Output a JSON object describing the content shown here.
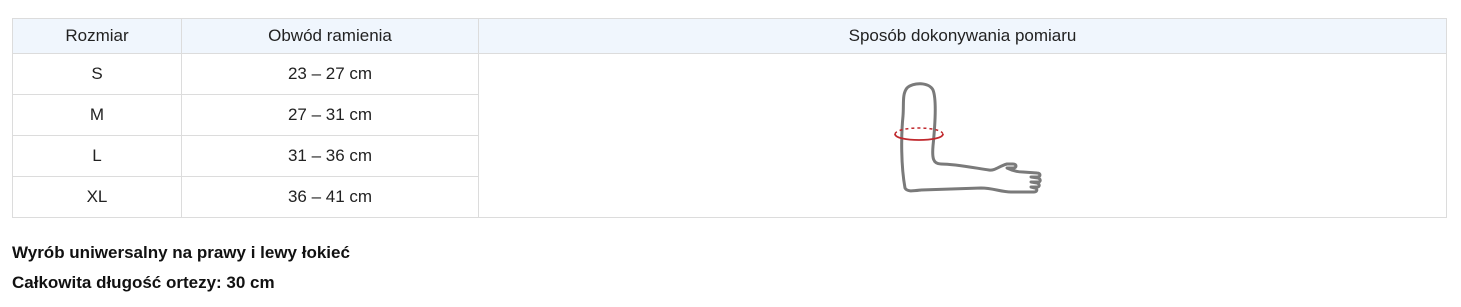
{
  "table": {
    "headers": [
      "Rozmiar",
      "Obwód ramienia",
      "Sposób dokonywania pomiaru"
    ],
    "rows": [
      {
        "size": "S",
        "circumference": "23 – 27 cm"
      },
      {
        "size": "M",
        "circumference": "27 – 31 cm"
      },
      {
        "size": "L",
        "circumference": "31 – 36 cm"
      },
      {
        "size": "XL",
        "circumference": "36 – 41 cm"
      }
    ],
    "illustration": "arm-measurement-icon"
  },
  "notes": {
    "line1": "Wyrób uniwersalny na prawy i lewy łokieć",
    "line2": "Całkowita długość ortezy: 30 cm"
  },
  "colors": {
    "header_bg": "#f0f6fd",
    "border": "#dcdcdc",
    "arm_outline": "#7a7a7a",
    "measure_ring": "#c0282d"
  }
}
